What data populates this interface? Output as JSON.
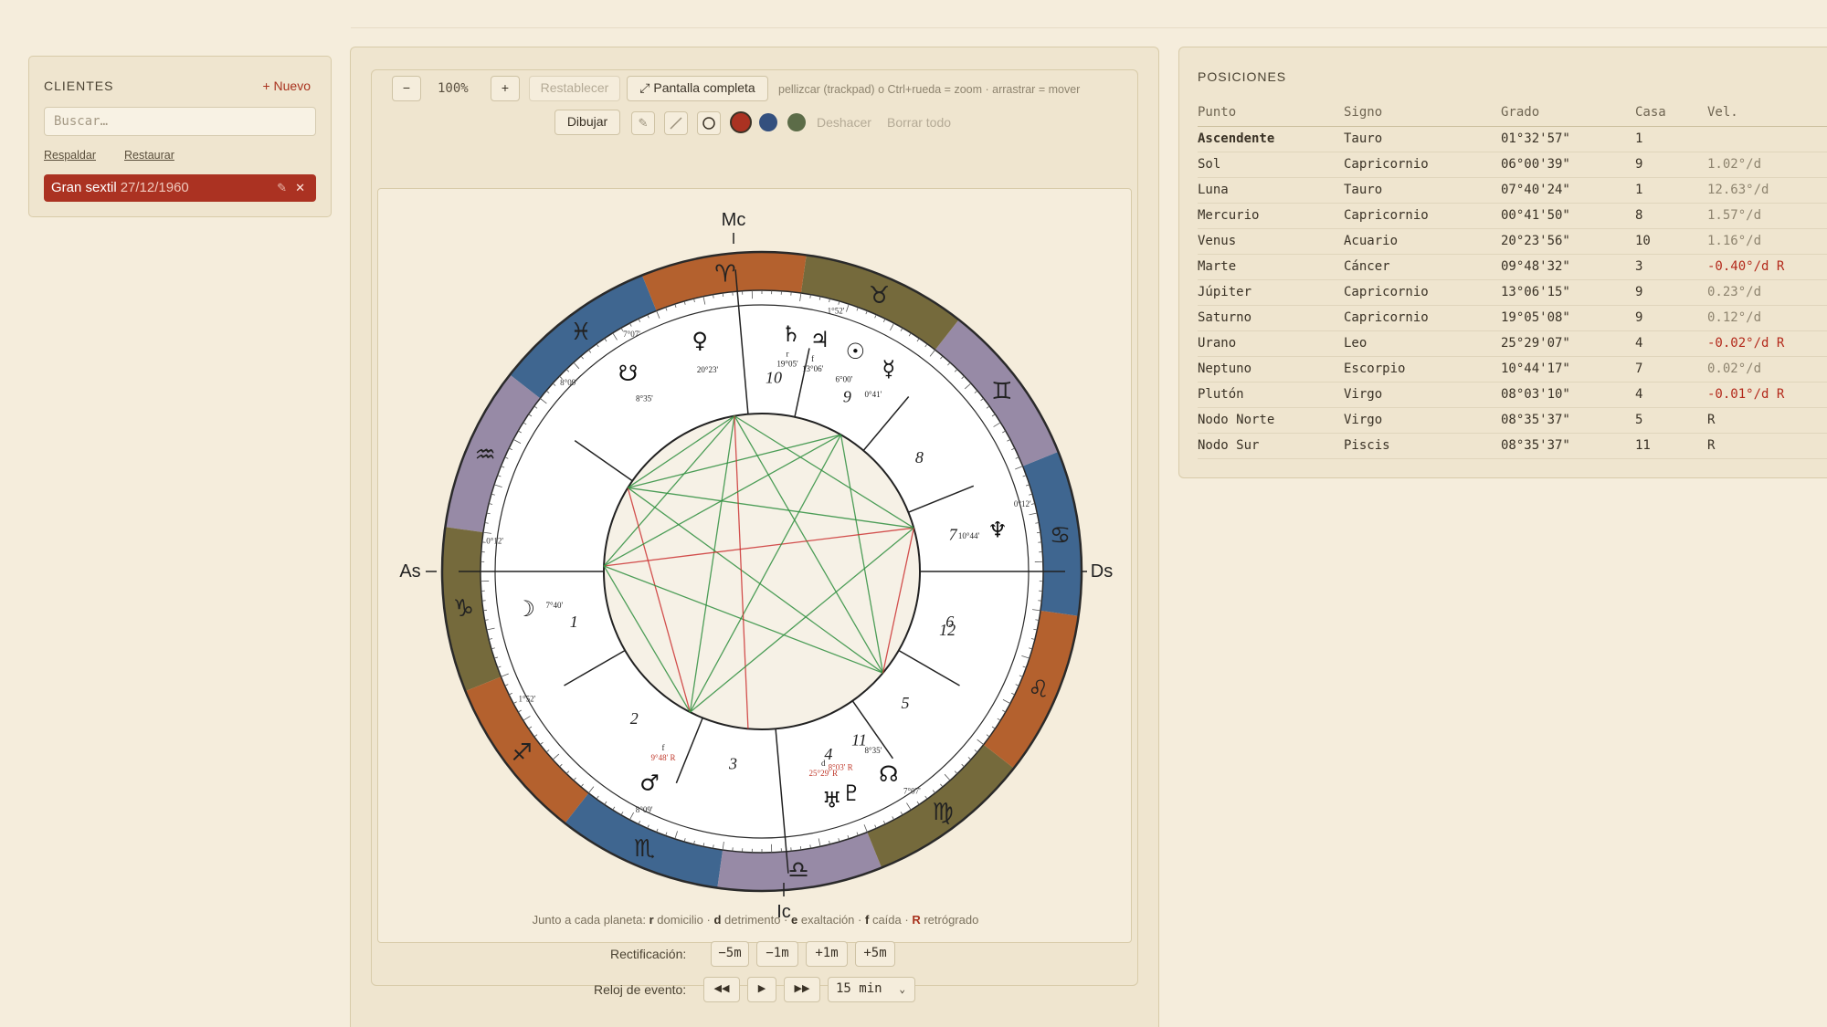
{
  "clients": {
    "title": "CLIENTES",
    "new_label": "+ Nuevo",
    "search_placeholder": "Buscar…",
    "backup_label": "Respaldar",
    "restore_label": "Restaurar",
    "items": [
      {
        "name": "Gran sextil",
        "date": "27/12/1960"
      }
    ]
  },
  "toolbar": {
    "zoom_out": "−",
    "zoom_level": "100%",
    "zoom_in": "+",
    "reset": "Restablecer",
    "fullscreen": "⤢ Pantalla completa",
    "hint": "pellizcar (trackpad) o Ctrl+rueda = zoom · arrastrar = mover",
    "draw": "Dibujar",
    "undo": "Deshacer",
    "clear": "Borrar todo",
    "colors": [
      "#ab3222",
      "#34507e",
      "#5c6c48"
    ]
  },
  "chart": {
    "angles": {
      "mc": "Mc",
      "ic": "Ic",
      "as": "As",
      "ds": "Ds"
    },
    "signs": [
      {
        "glyph": "♓",
        "name": "Piscis",
        "fill": "#3f6690"
      },
      {
        "glyph": "♒",
        "name": "Acuario",
        "fill": "#978aa6"
      },
      {
        "glyph": "♑",
        "name": "Capricornio",
        "fill": "#756a3c"
      },
      {
        "glyph": "♐",
        "name": "Sagitario",
        "fill": "#b4612e"
      },
      {
        "glyph": "♏",
        "name": "Escorpio",
        "fill": "#3f6690"
      },
      {
        "glyph": "♎",
        "name": "Libra",
        "fill": "#978aa6"
      },
      {
        "glyph": "♍",
        "name": "Virgo",
        "fill": "#756a3c"
      },
      {
        "glyph": "♌",
        "name": "Leo",
        "fill": "#b4612e"
      },
      {
        "glyph": "♋",
        "name": "Cáncer",
        "fill": "#3f6690"
      },
      {
        "glyph": "♊",
        "name": "Géminis",
        "fill": "#978aa6"
      },
      {
        "glyph": "♉",
        "name": "Tauro",
        "fill": "#756a3c"
      },
      {
        "glyph": "♈",
        "name": "Aries",
        "fill": "#b4612e"
      }
    ],
    "houses": [
      "10",
      "9",
      "8",
      "7",
      "6",
      "5",
      "4",
      "3",
      "2",
      "1",
      "12",
      "11"
    ],
    "cusp_labels": [
      "8°09'",
      "1°52'",
      "0°12'",
      "7°07'",
      "8°09'",
      "1°52'",
      "0°12'",
      "7°07'"
    ],
    "planets": [
      {
        "glyph": "♄",
        "deg": "19°05'",
        "dignity": "r",
        "retro": false
      },
      {
        "glyph": "♃",
        "deg": "13°06'",
        "dignity": "f",
        "retro": false
      },
      {
        "glyph": "☉",
        "deg": "6°00'",
        "dignity": "",
        "retro": false
      },
      {
        "glyph": "☿",
        "deg": "0°41'",
        "dignity": "",
        "retro": false
      },
      {
        "glyph": "♀",
        "deg": "20°23'",
        "dignity": "",
        "retro": false
      },
      {
        "glyph": "☋",
        "deg": "8°35'",
        "dignity": "",
        "retro": false
      },
      {
        "glyph": "♆",
        "deg": "10°44'",
        "dignity": "",
        "retro": false
      },
      {
        "glyph": "☽",
        "deg": "7°40'",
        "dignity": "",
        "retro": false
      },
      {
        "glyph": "♂",
        "deg": "9°48' R",
        "dignity": "f",
        "retro": true
      },
      {
        "glyph": "♅",
        "deg": "25°29' R",
        "dignity": "d",
        "retro": true
      },
      {
        "glyph": "♇",
        "deg": "8°03' R",
        "dignity": "",
        "retro": true
      },
      {
        "glyph": "☊",
        "deg": "8°35'",
        "dignity": "",
        "retro": false
      }
    ]
  },
  "legend": {
    "prefix": "Junto a cada planeta:",
    "r": "r",
    "r_text": "domicilio ·",
    "d": "d",
    "d_text": "detrimento ·",
    "e": "e",
    "e_text": "exaltación ·",
    "f": "f",
    "f_text": "caída ·",
    "R": "R",
    "R_text": "retrógrado"
  },
  "rectification": {
    "label": "Rectificación:",
    "buttons": [
      "−5m",
      "−1m",
      "+1m",
      "+5m"
    ]
  },
  "event_clock": {
    "label": "Reloj de evento:",
    "rewind": "◀◀",
    "play": "▶",
    "forward": "▶▶",
    "step": "15 min"
  },
  "positions": {
    "title": "POSICIONES",
    "headers": [
      "Punto",
      "Signo",
      "Grado",
      "Casa",
      "Vel."
    ],
    "rows": [
      {
        "point": "Ascendente",
        "sign": "Tauro",
        "degree": "01°32'57\"",
        "house": "1",
        "vel": "",
        "retro": false
      },
      {
        "point": "Sol",
        "sign": "Capricornio",
        "degree": "06°00'39\"",
        "house": "9",
        "vel": "1.02°/d",
        "retro": false
      },
      {
        "point": "Luna",
        "sign": "Tauro",
        "degree": "07°40'24\"",
        "house": "1",
        "vel": "12.63°/d",
        "retro": false
      },
      {
        "point": "Mercurio",
        "sign": "Capricornio",
        "degree": "00°41'50\"",
        "house": "8",
        "vel": "1.57°/d",
        "retro": false
      },
      {
        "point": "Venus",
        "sign": "Acuario",
        "degree": "20°23'56\"",
        "house": "10",
        "vel": "1.16°/d",
        "retro": false
      },
      {
        "point": "Marte",
        "sign": "Cáncer",
        "degree": "09°48'32\"",
        "house": "3",
        "vel": "-0.40°/d R",
        "retro": true
      },
      {
        "point": "Júpiter",
        "sign": "Capricornio",
        "degree": "13°06'15\"",
        "house": "9",
        "vel": "0.23°/d",
        "retro": false
      },
      {
        "point": "Saturno",
        "sign": "Capricornio",
        "degree": "19°05'08\"",
        "house": "9",
        "vel": "0.12°/d",
        "retro": false
      },
      {
        "point": "Urano",
        "sign": "Leo",
        "degree": "25°29'07\"",
        "house": "4",
        "vel": "-0.02°/d R",
        "retro": true
      },
      {
        "point": "Neptuno",
        "sign": "Escorpio",
        "degree": "10°44'17\"",
        "house": "7",
        "vel": "0.02°/d",
        "retro": false
      },
      {
        "point": "Plutón",
        "sign": "Virgo",
        "degree": "08°03'10\"",
        "house": "4",
        "vel": "-0.01°/d R",
        "retro": true
      },
      {
        "point": "Nodo Norte",
        "sign": "Virgo",
        "degree": "08°35'37\"",
        "house": "5",
        "vel": "R",
        "retro": false
      },
      {
        "point": "Nodo Sur",
        "sign": "Piscis",
        "degree": "08°35'37\"",
        "house": "11",
        "vel": "R",
        "retro": false
      }
    ]
  }
}
